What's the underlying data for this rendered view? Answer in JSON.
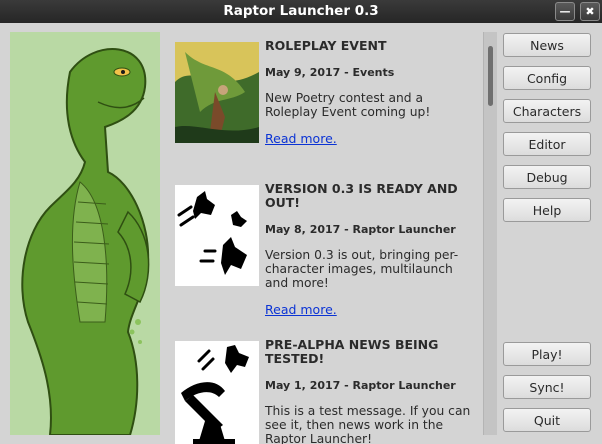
{
  "window": {
    "title": "Raptor Launcher 0.3"
  },
  "window_controls": {
    "minimize": "—",
    "close": "✖"
  },
  "news": [
    {
      "title": "ROLEPLAY EVENT",
      "meta": "May 9, 2017 - Events",
      "body": "New Poetry contest and a Roleplay Event coming up!",
      "link": "Read more."
    },
    {
      "title": "VERSION 0.3 IS READY AND OUT!",
      "meta": "May 8, 2017 - Raptor Launcher",
      "body": "Version 0.3 is out, bringing per-character images, multilaunch and more!",
      "link": "Read more."
    },
    {
      "title": "PRE-ALPHA NEWS BEING TESTED!",
      "meta": "May 1, 2017 - Raptor Launcher",
      "body": "This is a test message. If you can see it, then news work in the Raptor Launcher!",
      "link": ""
    }
  ],
  "buttons": {
    "news": "News",
    "config": "Config",
    "characters": "Characters",
    "editor": "Editor",
    "debug": "Debug",
    "help": "Help",
    "play": "Play!",
    "sync": "Sync!",
    "quit": "Quit"
  },
  "colors": {
    "link": "#0b33d4",
    "titlebar": "#2e2e2e",
    "art_green": "#5f9a2e"
  }
}
